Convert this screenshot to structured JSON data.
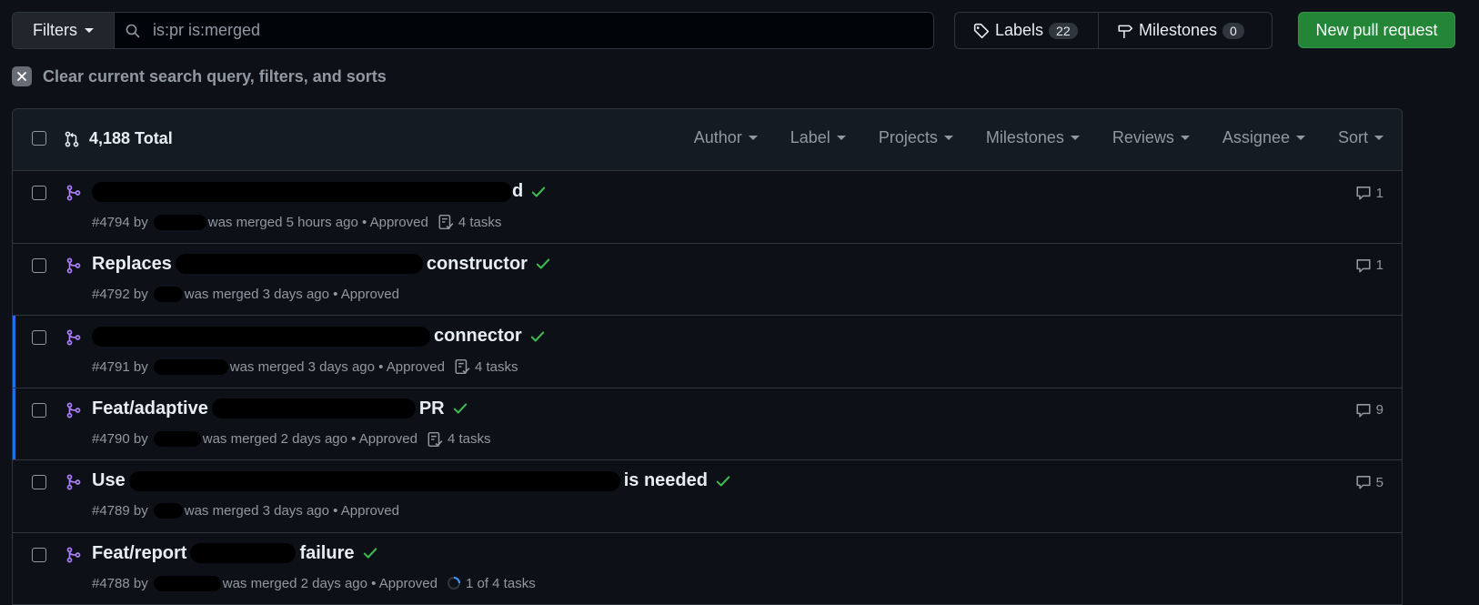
{
  "toolbar": {
    "filters_label": "Filters",
    "search_value": "is:pr is:merged",
    "labels_label": "Labels",
    "labels_count": "22",
    "milestones_label": "Milestones",
    "milestones_count": "0",
    "new_pr_label": "New pull request"
  },
  "clear": {
    "label": "Clear current search query, filters, and sorts"
  },
  "list_header": {
    "total": "4,188 Total",
    "menus": [
      "Author",
      "Label",
      "Projects",
      "Milestones",
      "Reviews",
      "Assignee",
      "Sort"
    ]
  },
  "rows": [
    {
      "title_start": "",
      "title_end": "d",
      "meta": "#4794 by",
      "merged": "was merged 5 hours ago",
      "approved": "• Approved",
      "tasks": "4 tasks",
      "comments": "1"
    },
    {
      "title_start": "Replaces",
      "title_end": "constructor",
      "meta": "#4792 by",
      "merged": "was merged 3 days ago",
      "approved": "• Approved",
      "tasks": "",
      "comments": "1"
    },
    {
      "title_start": "",
      "title_end": "connector",
      "meta": "#4791 by",
      "merged": "was merged 3 days ago",
      "approved": "• Approved",
      "tasks": "4 tasks",
      "comments": ""
    },
    {
      "title_start": "Feat/adaptive",
      "title_end": "PR",
      "meta": "#4790 by",
      "merged": "was merged 2 days ago",
      "approved": "• Approved",
      "tasks": "4 tasks",
      "comments": "9"
    },
    {
      "title_start": "Use",
      "title_end": "is needed",
      "meta": "#4789 by",
      "merged": "was merged 3 days ago",
      "approved": "• Approved",
      "tasks": "",
      "comments": "5"
    },
    {
      "title_start": "Feat/report",
      "title_end": "failure",
      "meta": "#4788 by",
      "merged": "was merged 2 days ago",
      "approved": "• Approved",
      "tasks": "1 of 4 tasks",
      "comments": ""
    }
  ],
  "colors": {
    "merged_icon": "#ab7df8",
    "check": "#3fb950",
    "unread_bar": "#1f6feb",
    "primary_button": "#238636"
  }
}
